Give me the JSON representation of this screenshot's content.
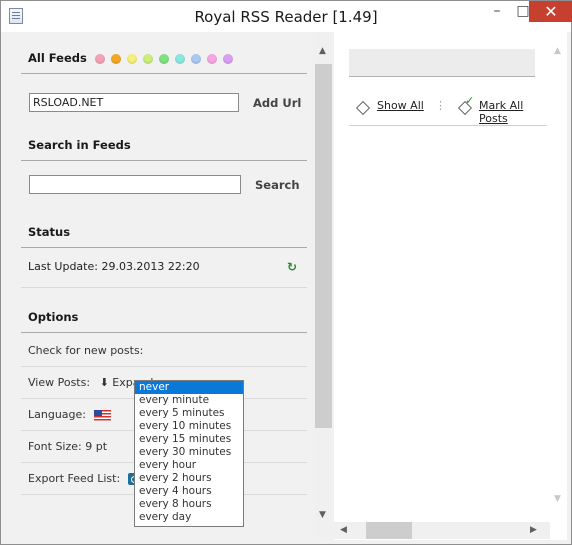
{
  "window": {
    "title": "Royal RSS Reader [1.49]",
    "min_glyph": "–",
    "max_glyph": "□",
    "close_glyph": "✕"
  },
  "feeds": {
    "heading": "All Feeds",
    "dot_colors": [
      "#f3a3b5",
      "#f5a623",
      "#f7f07a",
      "#c9ef7c",
      "#7fe27f",
      "#8ce6e0",
      "#a9c9f0",
      "#f6a6e0",
      "#d9a0f0"
    ],
    "url_value": "RSLOAD.NET",
    "add_url_label": "Add Url"
  },
  "search": {
    "heading": "Search in Feeds",
    "input_value": "",
    "button_label": "Search"
  },
  "status": {
    "heading": "Status",
    "last_update": "Last Update: 29.03.2013 22:20"
  },
  "options": {
    "heading": "Options",
    "check_label": "Check for new posts:",
    "view_label": "View Posts:",
    "view_value": "Expand",
    "language_label": "Language:",
    "font_size_label": "Font Size: 9 pt",
    "export_label": "Export Feed List:"
  },
  "dropdown": {
    "options": [
      "never",
      "every minute",
      "every 5 minutes",
      "every 10 minutes",
      "every 15 minutes",
      "every 30 minutes",
      "every hour",
      "every 2 hours",
      "every 4 hours",
      "every 8 hours",
      "every day"
    ],
    "selected_index": 0
  },
  "posts_toolbar": {
    "show_all": "Show All",
    "mark_all": "Mark All Posts"
  },
  "colors": {
    "selection": "#0a78d7",
    "close_button": "#c7402f",
    "refresh": "#2b8a2b"
  }
}
